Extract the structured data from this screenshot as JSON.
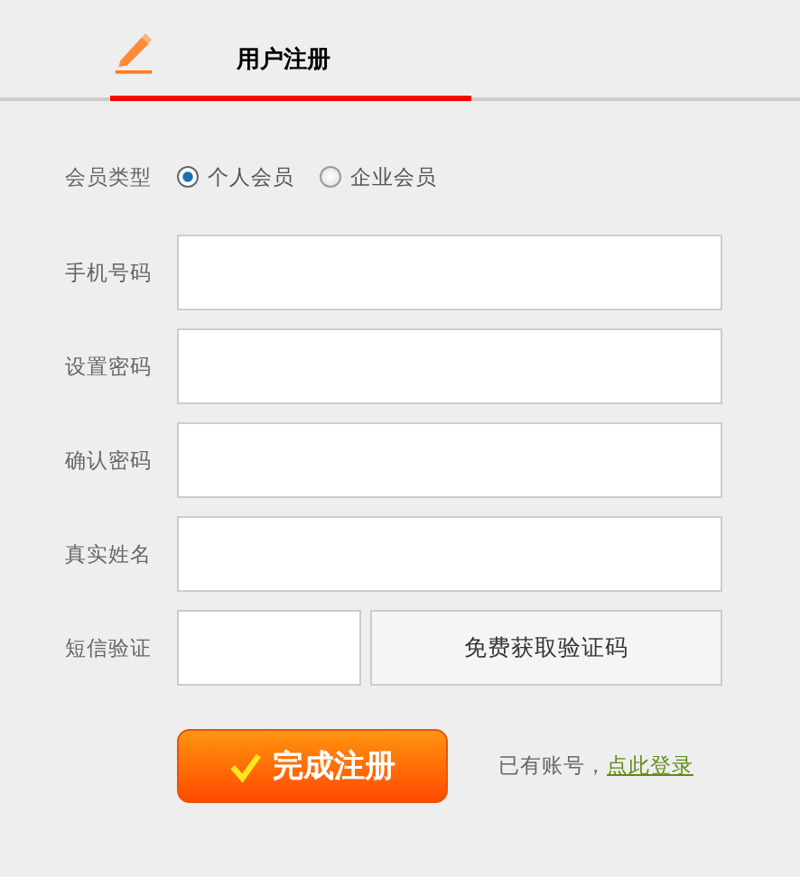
{
  "tabs": [
    {
      "label": "用户注册",
      "selected": true
    }
  ],
  "member_type": {
    "label": "会员类型",
    "options": [
      {
        "label": "个人会员",
        "selected": true
      },
      {
        "label": "企业会员",
        "selected": false
      }
    ]
  },
  "fields": [
    {
      "label": "手机号码",
      "kind": "text"
    },
    {
      "label": "设置密码",
      "kind": "text"
    },
    {
      "label": "确认密码",
      "kind": "text"
    },
    {
      "label": "真实姓名",
      "kind": "text"
    },
    {
      "label": "短信验证",
      "kind": "code",
      "button": "免费获取验证码"
    }
  ],
  "submit": "完成注册",
  "login_prompt": "已有账号，",
  "login_link": "点此登录"
}
